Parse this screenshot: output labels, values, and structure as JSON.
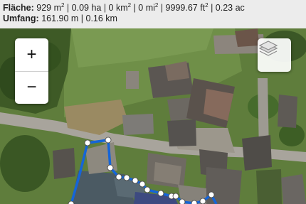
{
  "measurement": {
    "area_label": "Fläche:",
    "area_value_1": "929 m",
    "area_sup_1": "2",
    "area_value_2": " | 0.09 ha | 0 km",
    "area_sup_2": "2",
    "area_value_3": " | 0 mi",
    "area_sup_3": "2",
    "area_value_4": " | 9999.67 ft",
    "area_sup_4": "2",
    "area_value_5": " | 0.23 ac",
    "perimeter_label": "Umfang:",
    "perimeter_value": "161.90 m | 0.16 km"
  },
  "controls": {
    "zoom_in_label": "+",
    "zoom_out_label": "−",
    "layers_icon": "layers-icon"
  },
  "colors": {
    "polygon_stroke": "#1565d8",
    "vertex_fill": "#ffffff"
  }
}
